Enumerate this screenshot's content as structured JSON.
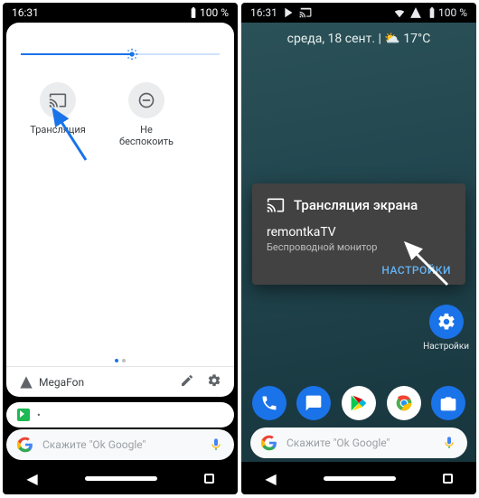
{
  "left": {
    "status": {
      "time": "16:31",
      "battery": "100 %"
    },
    "slider": {
      "value": 56
    },
    "tiles": [
      {
        "name": "cast",
        "label": "Трансляция"
      },
      {
        "name": "dnd",
        "label": "Не беспокоить"
      }
    ],
    "footer": {
      "carrier": "MegaFon"
    },
    "notification": {
      "app_label": "•"
    },
    "search": {
      "placeholder": "Скажите \"Ok Google\""
    }
  },
  "right": {
    "status": {
      "time": "16:31",
      "battery": "100 %"
    },
    "date_weather": "среда, 18 сент. | ⛅ 17°C",
    "cast_dialog": {
      "title": "Трансляция экрана",
      "device": "remontkaTV",
      "subtitle": "Беспроводной монитор",
      "settings_btn": "НАСТРОЙКИ"
    },
    "settings_shortcut": {
      "label": "Настройки"
    },
    "search": {
      "placeholder": "Скажите \"Ok Google\""
    }
  }
}
